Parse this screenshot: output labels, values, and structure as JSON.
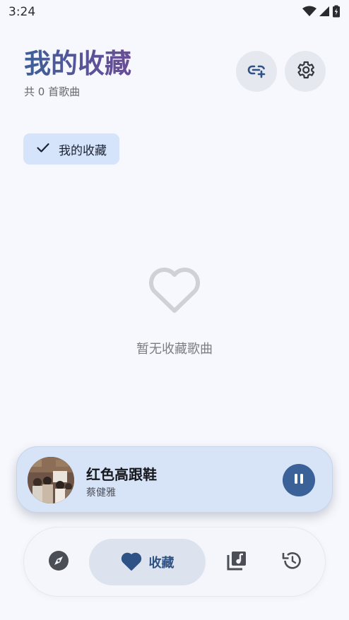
{
  "status_bar": {
    "time": "3:24",
    "icons": [
      "wifi-icon",
      "signal-icon",
      "battery-charging-icon"
    ]
  },
  "header": {
    "title": "我的收藏",
    "subtitle": "共 0 首歌曲",
    "actions": [
      "link-add-icon",
      "gear-icon"
    ]
  },
  "filter_chip": {
    "label": "我的收藏",
    "selected": true,
    "icon": "check-icon"
  },
  "empty_state": {
    "icon": "heart-outline-icon",
    "message": "暂无收藏歌曲"
  },
  "mini_player": {
    "title": "红色高跟鞋",
    "artist": "蔡健雅",
    "state_icon": "pause-icon"
  },
  "bottom_nav": {
    "items": [
      {
        "icon": "compass-icon",
        "label": "",
        "active": false
      },
      {
        "icon": "heart-icon",
        "label": "收藏",
        "active": true
      },
      {
        "icon": "music-library-icon",
        "label": "",
        "active": false
      },
      {
        "icon": "history-icon",
        "label": "",
        "active": false
      }
    ]
  },
  "colors": {
    "background": "#f7f8fd",
    "accent": "#3a6198",
    "chip_bg": "#d5e3fb",
    "player_bg": "#d7e3f6",
    "nav_active_bg": "#dce3ee"
  }
}
